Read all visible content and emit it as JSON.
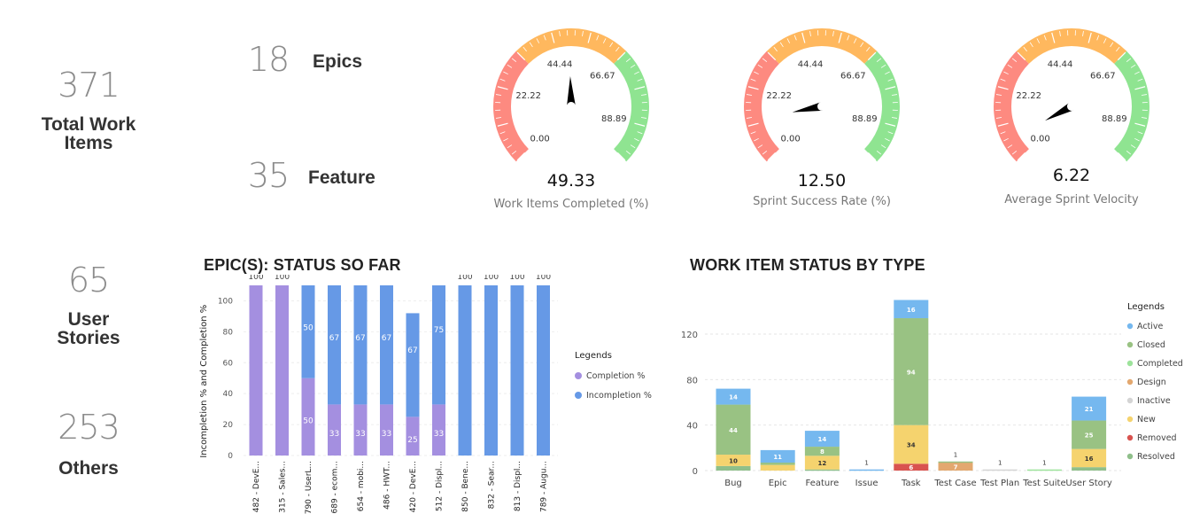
{
  "kpis": {
    "total_work_items": {
      "value": "371",
      "label_line1": "Total Work",
      "label_line2": "Items"
    },
    "epics": {
      "value": "18",
      "label": "Epics"
    },
    "feature": {
      "value": "35",
      "label": "Feature"
    },
    "user_stories": {
      "value": "65",
      "label_line1": "User",
      "label_line2": "Stories"
    },
    "others": {
      "value": "253",
      "label": "Others"
    }
  },
  "gauges": [
    {
      "value": 49.33,
      "display": "49.33",
      "caption": "Work Items Completed (%)",
      "min": 0,
      "max": 100,
      "tick_labels": [
        "0.00",
        "22.22",
        "44.44",
        "66.67",
        "88.89"
      ]
    },
    {
      "value": 12.5,
      "display": "12.50",
      "caption": "Sprint Success Rate (%)",
      "min": 0,
      "max": 100,
      "tick_labels": [
        "0.00",
        "22.22",
        "44.44",
        "66.67",
        "88.89"
      ]
    },
    {
      "value": 6.22,
      "display": "6.22",
      "caption": "Average Sprint Velocity",
      "min": 0,
      "max": 100,
      "tick_labels": [
        "0.00",
        "22.22",
        "44.44",
        "66.67",
        "88.89"
      ]
    }
  ],
  "gauge_colors": {
    "low": "#fd8a80",
    "mid": "#ffb85e",
    "high": "#8fe491",
    "needle": "#000000"
  },
  "chart_data": [
    {
      "type": "bar",
      "stacked": true,
      "title": "EPIC(S): STATUS SO FAR",
      "xlabel": "",
      "ylabel": "Incompletion % and Completion %",
      "ylim": [
        0,
        110
      ],
      "yticks": [
        0,
        20,
        40,
        60,
        80,
        100
      ],
      "grid": true,
      "legend_title": "Legends",
      "legend_position": "right",
      "categories": [
        "482 - DevE...",
        "315 - Sales...",
        "790 - UserL...",
        "689 - ecom...",
        "654 - mobi...",
        "486 - HWT...",
        "420 - DevE...",
        "512 - Displ...",
        "850 - Bene...",
        "832 - Sear...",
        "813 - Displ...",
        "789 - Augu..."
      ],
      "series": [
        {
          "name": "Completion %",
          "color": "#a48fe0",
          "values": [
            100,
            100,
            50,
            33,
            33,
            33,
            25,
            33,
            0,
            0,
            0,
            0
          ]
        },
        {
          "name": "Incompletion %",
          "color": "#6699e6",
          "values": [
            0,
            0,
            50,
            67,
            67,
            67,
            67,
            75,
            100,
            100,
            100,
            100
          ]
        }
      ],
      "top_labels": [
        "100",
        "100",
        "",
        "",
        "",
        "",
        "",
        "",
        "100",
        "100",
        "100",
        "100"
      ]
    },
    {
      "type": "bar",
      "stacked": true,
      "title": "WORK ITEM STATUS BY TYPE",
      "xlabel": "",
      "ylabel": "",
      "ylim": [
        0,
        120
      ],
      "yticks": [
        0,
        40,
        80,
        120
      ],
      "grid": true,
      "legend_title": "Legends",
      "legend_position": "right",
      "categories": [
        "Bug",
        "Epic",
        "Feature",
        "Issue",
        "Task",
        "Test Case",
        "Test Plan",
        "Test Suite",
        "User Story"
      ],
      "series": [
        {
          "name": "Resolved",
          "color": "#8fbf8a",
          "values": [
            4,
            0,
            1,
            0,
            0,
            0,
            0,
            0,
            3
          ]
        },
        {
          "name": "Removed",
          "color": "#d9534f",
          "values": [
            0,
            0,
            0,
            0,
            6,
            0,
            0,
            0,
            0
          ]
        },
        {
          "name": "New",
          "color": "#f5d36e",
          "values": [
            10,
            5,
            12,
            0,
            34,
            0,
            0,
            0,
            16
          ]
        },
        {
          "name": "Inactive",
          "color": "#d4d4d4",
          "values": [
            0,
            0,
            0,
            0,
            0,
            0,
            1,
            0,
            0
          ]
        },
        {
          "name": "Design",
          "color": "#e3a86f",
          "values": [
            0,
            0,
            0,
            0,
            0,
            7,
            0,
            0,
            0
          ]
        },
        {
          "name": "Completed",
          "color": "#9de39b",
          "values": [
            0,
            0,
            0,
            0,
            0,
            0,
            0,
            1,
            0
          ]
        },
        {
          "name": "Closed",
          "color": "#99c283",
          "values": [
            44,
            2,
            8,
            0,
            94,
            1,
            0,
            0,
            25
          ]
        },
        {
          "name": "Active",
          "color": "#75b8ef",
          "values": [
            14,
            11,
            14,
            1,
            16,
            0,
            0,
            0,
            21
          ]
        }
      ],
      "legend_order": [
        "Active",
        "Closed",
        "Completed",
        "Design",
        "Inactive",
        "New",
        "Removed",
        "Resolved"
      ],
      "value_labels": [
        [
          "",
          "",
          "",
          "",
          "",
          "",
          "",
          ""
        ],
        [],
        [],
        [],
        [],
        [],
        [],
        [],
        []
      ]
    }
  ]
}
